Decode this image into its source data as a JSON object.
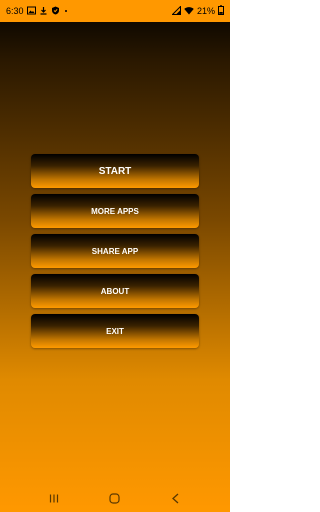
{
  "status_bar": {
    "time": "6:30",
    "battery": "21%",
    "icons": [
      "photo-icon",
      "download-icon",
      "shield-check-icon",
      "dot-icon",
      "signal-icon",
      "wifi-icon",
      "battery-icon"
    ]
  },
  "menu": {
    "items": [
      {
        "label": "START"
      },
      {
        "label": "MORE APPS"
      },
      {
        "label": "SHARE APP"
      },
      {
        "label": "ABOUT"
      },
      {
        "label": "EXIT"
      }
    ]
  },
  "nav_bar": {
    "icons": [
      "recents-icon",
      "home-icon",
      "back-icon"
    ]
  },
  "colors": {
    "accent": "#ff9800",
    "text": "#ffffff",
    "background_top": "#000000"
  }
}
